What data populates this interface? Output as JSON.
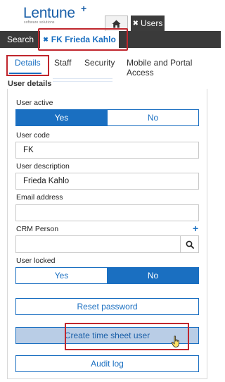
{
  "logo": {
    "name": "Lentune",
    "plus": "+",
    "tagline": "software solutions"
  },
  "top_tabs": {
    "home_icon": "home-icon",
    "users_label": "Users",
    "close_glyph": "✖"
  },
  "bar": {
    "search_label": "Search",
    "person_tab_label": "FK Frieda Kahlo",
    "close_glyph": "✖"
  },
  "sub_tabs": [
    {
      "label": "Details",
      "active": true
    },
    {
      "label": "Staff",
      "active": false
    },
    {
      "label": "Security",
      "active": false
    },
    {
      "label": "Mobile and Portal Access",
      "active": false
    }
  ],
  "section_title": "User details",
  "form": {
    "user_active": {
      "label": "User active",
      "options": [
        "Yes",
        "No"
      ],
      "selected": "Yes"
    },
    "user_code": {
      "label": "User code",
      "value": "FK"
    },
    "user_description": {
      "label": "User description",
      "value": "Frieda Kahlo"
    },
    "email": {
      "label": "Email address",
      "value": ""
    },
    "crm_person": {
      "label": "CRM Person",
      "value": "",
      "add_glyph": "+"
    },
    "user_locked": {
      "label": "User locked",
      "options": [
        "Yes",
        "No"
      ],
      "selected": "No"
    }
  },
  "buttons": {
    "reset_password": "Reset password",
    "create_timesheet_user": "Create time sheet user",
    "audit_log": "Audit log"
  },
  "colors": {
    "accent": "#1a6fc1",
    "highlight": "#c0262d",
    "dark_bar": "#3a3a3a",
    "hover_fill": "#b9cde6"
  }
}
